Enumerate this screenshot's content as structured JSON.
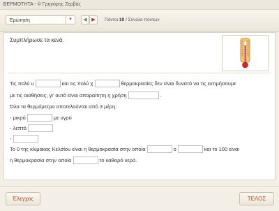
{
  "window": {
    "title": "ΘΕΡΜΟΤΗΤΑ - © Γρηγόρης Ζερβός"
  },
  "toolbar": {
    "mode_select": "Ερώτηση",
    "counter_label": "Πόντοι",
    "points": "10",
    "separator": "/",
    "total_label": "Σύνολο πόντων"
  },
  "exercise": {
    "instruction": "Συμπλήρωσε τα κενά.",
    "line1_a": "Τις πολύ υ",
    "line1_b": "και τις πολύ χ",
    "line1_c": "θερμοκρασίες δεν είναι δυνατό να τις εκτιμήσουμε",
    "line2_a": "με τις αισθήσεις, γι' αυτό είναι απαραίτητη η χρήση",
    "line2_b": ".",
    "line3": "Όλα τα θερμόμετρα αποτελούνται από 3 μέρη:",
    "line4_a": "- μικρό",
    "line4_b": "με υγρό",
    "line5": "- λεπτό",
    "line6": "-",
    "line7_a": "Το 0 της κλίμακας Κελσίου είναι η θερμοκρασία στην οποία",
    "line7_b": "ο",
    "line7_c": "και το 100 είναι",
    "line8_a": "η θερμοκρασία στην οποία",
    "line8_b": "το καθαρό νερό."
  },
  "footer": {
    "check_button": "Έλεγχος",
    "end_button": "ΤΕΛΟΣ"
  },
  "colors": {
    "accent_text": "#b5462c",
    "thermometer_red": "#d7261a",
    "thermometer_scale": "#d9903c"
  }
}
